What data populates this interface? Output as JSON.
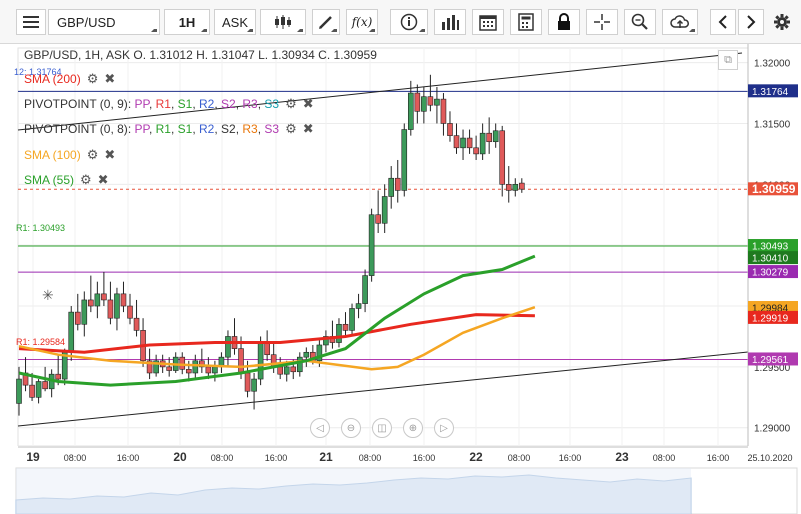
{
  "toolbar": {
    "symbol": "GBP/USD",
    "timeframe": "1H",
    "price_side": "ASK",
    "fx_label": "f(x)",
    "icons": [
      "menu-icon",
      "candlestick-icon",
      "draw-line-icon",
      "function-icon",
      "info-icon",
      "bar-chart-icon",
      "calendar-icon",
      "calculator-icon",
      "lock-icon",
      "crosshair-icon",
      "zoom-icon",
      "cloud-upload-icon",
      "chevron-left-icon",
      "chevron-right-icon",
      "gear-icon"
    ]
  },
  "header": {
    "ohlc": "GBP/USD, 1H, ASK   O. 1.31012 H. 1.31047 L. 1.30934 C. 1.30959"
  },
  "legend": {
    "sma200": {
      "label": "SMA (200)",
      "color": "#e8281e",
      "prefix": "12: 1.31764"
    },
    "pivot1": {
      "name": "PIVOTPOINT (0, 9)",
      "sep": ": ",
      "items": [
        {
          "t": "PP",
          "c": "#b03ab0"
        },
        {
          "t": "R1",
          "c": "#e83a3a"
        },
        {
          "t": "S1",
          "c": "#2aa02a"
        },
        {
          "t": "R2",
          "c": "#3a5fd0"
        },
        {
          "t": "S2",
          "c": "#b03ab0"
        },
        {
          "t": "R3",
          "c": "#b03ab0"
        },
        {
          "t": "S3",
          "c": "#16a0b0"
        }
      ]
    },
    "pivot2": {
      "name": "PIVOTPOINT (0, 8)",
      "sep": ": ",
      "items": [
        {
          "t": "PP",
          "c": "#b03ab0"
        },
        {
          "t": "R1",
          "c": "#2aa02a"
        },
        {
          "t": "S1",
          "c": "#2aa02a"
        },
        {
          "t": "R2",
          "c": "#3a5fd0"
        },
        {
          "t": "S2",
          "c": "#333333"
        },
        {
          "t": "R3",
          "c": "#e8760a"
        },
        {
          "t": "S3",
          "c": "#b03ab0"
        }
      ]
    },
    "sma100": {
      "label": "SMA (100)",
      "color": "#f5a623"
    },
    "sma55": {
      "label": "SMA (55)",
      "color": "#2aa02a"
    },
    "r1_text": "R1: 1.30493",
    "s_text": "R1: 1.29584"
  },
  "price_axis": {
    "ticks": [
      "1.32000",
      "1.31500",
      "1.31000",
      "1.30500",
      "1.30000",
      "1.29500",
      "1.29000"
    ],
    "badges": [
      {
        "text": "1.31764",
        "bg": "#1f2f8a",
        "fg": "#ffffff"
      },
      {
        "text": "1.30959",
        "bg": "#e8523a",
        "fg": "#ffffff"
      },
      {
        "text": "1.30493",
        "bg": "#2aa02a",
        "fg": "#ffffff"
      },
      {
        "text": "1.30410",
        "bg": "#1e7a1e",
        "fg": "#ffffff"
      },
      {
        "text": "1.30279",
        "bg": "#9a2ab0",
        "fg": "#ffffff"
      },
      {
        "text": "1.29984",
        "bg": "#f5a623",
        "fg": "#222222"
      },
      {
        "text": "1.29919",
        "bg": "#e8281e",
        "fg": "#ffffff"
      },
      {
        "text": "1.29561",
        "bg": "#b03ab0",
        "fg": "#ffffff"
      }
    ]
  },
  "time_axis": {
    "labels": [
      "19",
      "08:00",
      "16:00",
      "20",
      "08:00",
      "16:00",
      "21",
      "08:00",
      "16:00",
      "22",
      "08:00",
      "16:00",
      "23",
      "08:00",
      "16:00",
      "25.10.2020"
    ],
    "bold": [
      true,
      false,
      false,
      true,
      false,
      false,
      true,
      false,
      false,
      true,
      false,
      false,
      true,
      false,
      false,
      false
    ]
  },
  "chart_data": {
    "type": "candlestick",
    "ylim": [
      1.2885,
      1.3212
    ],
    "candles": [
      {
        "o": 1.292,
        "h": 1.295,
        "l": 1.291,
        "c": 1.294
      },
      {
        "o": 1.2945,
        "h": 1.2958,
        "l": 1.293,
        "c": 1.2935
      },
      {
        "o": 1.2935,
        "h": 1.2945,
        "l": 1.2922,
        "c": 1.2925
      },
      {
        "o": 1.2925,
        "h": 1.294,
        "l": 1.292,
        "c": 1.2938
      },
      {
        "o": 1.2938,
        "h": 1.295,
        "l": 1.293,
        "c": 1.2932
      },
      {
        "o": 1.2932,
        "h": 1.2948,
        "l": 1.2925,
        "c": 1.2944
      },
      {
        "o": 1.2944,
        "h": 1.296,
        "l": 1.2935,
        "c": 1.294
      },
      {
        "o": 1.294,
        "h": 1.2965,
        "l": 1.2935,
        "c": 1.2962
      },
      {
        "o": 1.2962,
        "h": 1.3,
        "l": 1.2955,
        "c": 1.2995
      },
      {
        "o": 1.2995,
        "h": 1.301,
        "l": 1.298,
        "c": 1.2985
      },
      {
        "o": 1.2985,
        "h": 1.3012,
        "l": 1.2975,
        "c": 1.3005
      },
      {
        "o": 1.3005,
        "h": 1.3025,
        "l": 1.2995,
        "c": 1.3
      },
      {
        "o": 1.3,
        "h": 1.302,
        "l": 1.299,
        "c": 1.301
      },
      {
        "o": 1.301,
        "h": 1.3028,
        "l": 1.3,
        "c": 1.3005
      },
      {
        "o": 1.3005,
        "h": 1.302,
        "l": 1.2985,
        "c": 1.299
      },
      {
        "o": 1.299,
        "h": 1.3015,
        "l": 1.298,
        "c": 1.301
      },
      {
        "o": 1.301,
        "h": 1.302,
        "l": 1.2995,
        "c": 1.3
      },
      {
        "o": 1.3,
        "h": 1.301,
        "l": 1.2985,
        "c": 1.299
      },
      {
        "o": 1.299,
        "h": 1.3005,
        "l": 1.2975,
        "c": 1.298
      },
      {
        "o": 1.298,
        "h": 1.299,
        "l": 1.295,
        "c": 1.2955
      },
      {
        "o": 1.2955,
        "h": 1.2965,
        "l": 1.294,
        "c": 1.2945
      },
      {
        "o": 1.2945,
        "h": 1.296,
        "l": 1.2942,
        "c": 1.2955
      },
      {
        "o": 1.2955,
        "h": 1.296,
        "l": 1.2945,
        "c": 1.295
      },
      {
        "o": 1.295,
        "h": 1.2958,
        "l": 1.2942,
        "c": 1.2947
      },
      {
        "o": 1.2947,
        "h": 1.2962,
        "l": 1.2945,
        "c": 1.2958
      },
      {
        "o": 1.2958,
        "h": 1.2962,
        "l": 1.2944,
        "c": 1.2948
      },
      {
        "o": 1.2948,
        "h": 1.2955,
        "l": 1.2938,
        "c": 1.2945
      },
      {
        "o": 1.2945,
        "h": 1.296,
        "l": 1.294,
        "c": 1.2955
      },
      {
        "o": 1.2955,
        "h": 1.2965,
        "l": 1.2945,
        "c": 1.295
      },
      {
        "o": 1.295,
        "h": 1.2958,
        "l": 1.294,
        "c": 1.2945
      },
      {
        "o": 1.2945,
        "h": 1.2955,
        "l": 1.2938,
        "c": 1.295
      },
      {
        "o": 1.295,
        "h": 1.2962,
        "l": 1.2945,
        "c": 1.2958
      },
      {
        "o": 1.2958,
        "h": 1.298,
        "l": 1.295,
        "c": 1.2975
      },
      {
        "o": 1.2975,
        "h": 1.299,
        "l": 1.296,
        "c": 1.2965
      },
      {
        "o": 1.2965,
        "h": 1.2975,
        "l": 1.294,
        "c": 1.2945
      },
      {
        "o": 1.2945,
        "h": 1.2955,
        "l": 1.2925,
        "c": 1.293
      },
      {
        "o": 1.293,
        "h": 1.2945,
        "l": 1.2915,
        "c": 1.294
      },
      {
        "o": 1.294,
        "h": 1.2975,
        "l": 1.2935,
        "c": 1.297
      },
      {
        "o": 1.297,
        "h": 1.298,
        "l": 1.2955,
        "c": 1.296
      },
      {
        "o": 1.296,
        "h": 1.297,
        "l": 1.2945,
        "c": 1.295
      },
      {
        "o": 1.295,
        "h": 1.2958,
        "l": 1.294,
        "c": 1.2944
      },
      {
        "o": 1.2944,
        "h": 1.2955,
        "l": 1.2938,
        "c": 1.295
      },
      {
        "o": 1.295,
        "h": 1.2956,
        "l": 1.294,
        "c": 1.2946
      },
      {
        "o": 1.2946,
        "h": 1.2962,
        "l": 1.2942,
        "c": 1.2958
      },
      {
        "o": 1.2958,
        "h": 1.2966,
        "l": 1.295,
        "c": 1.2962
      },
      {
        "o": 1.2962,
        "h": 1.2968,
        "l": 1.2952,
        "c": 1.2955
      },
      {
        "o": 1.2955,
        "h": 1.2972,
        "l": 1.295,
        "c": 1.2968
      },
      {
        "o": 1.2968,
        "h": 1.298,
        "l": 1.2962,
        "c": 1.2975
      },
      {
        "o": 1.2975,
        "h": 1.2988,
        "l": 1.2965,
        "c": 1.297
      },
      {
        "o": 1.297,
        "h": 1.299,
        "l": 1.2966,
        "c": 1.2985
      },
      {
        "o": 1.2985,
        "h": 1.2995,
        "l": 1.2976,
        "c": 1.298
      },
      {
        "o": 1.298,
        "h": 1.3002,
        "l": 1.2975,
        "c": 1.2998
      },
      {
        "o": 1.2998,
        "h": 1.301,
        "l": 1.299,
        "c": 1.3002
      },
      {
        "o": 1.3002,
        "h": 1.303,
        "l": 1.2995,
        "c": 1.3025
      },
      {
        "o": 1.3025,
        "h": 1.308,
        "l": 1.302,
        "c": 1.3075
      },
      {
        "o": 1.3075,
        "h": 1.3095,
        "l": 1.306,
        "c": 1.3068
      },
      {
        "o": 1.3068,
        "h": 1.31,
        "l": 1.306,
        "c": 1.309
      },
      {
        "o": 1.309,
        "h": 1.3115,
        "l": 1.308,
        "c": 1.3105
      },
      {
        "o": 1.3105,
        "h": 1.312,
        "l": 1.3085,
        "c": 1.3095
      },
      {
        "o": 1.3095,
        "h": 1.315,
        "l": 1.309,
        "c": 1.3145
      },
      {
        "o": 1.3145,
        "h": 1.3185,
        "l": 1.314,
        "c": 1.3175
      },
      {
        "o": 1.3175,
        "h": 1.3182,
        "l": 1.315,
        "c": 1.316
      },
      {
        "o": 1.316,
        "h": 1.318,
        "l": 1.315,
        "c": 1.3172
      },
      {
        "o": 1.3172,
        "h": 1.319,
        "l": 1.316,
        "c": 1.3165
      },
      {
        "o": 1.3165,
        "h": 1.318,
        "l": 1.315,
        "c": 1.317
      },
      {
        "o": 1.317,
        "h": 1.3175,
        "l": 1.314,
        "c": 1.315
      },
      {
        "o": 1.315,
        "h": 1.316,
        "l": 1.3135,
        "c": 1.314
      },
      {
        "o": 1.314,
        "h": 1.315,
        "l": 1.3125,
        "c": 1.313
      },
      {
        "o": 1.313,
        "h": 1.3145,
        "l": 1.312,
        "c": 1.3138
      },
      {
        "o": 1.3138,
        "h": 1.3145,
        "l": 1.3125,
        "c": 1.313
      },
      {
        "o": 1.313,
        "h": 1.314,
        "l": 1.312,
        "c": 1.3125
      },
      {
        "o": 1.3125,
        "h": 1.315,
        "l": 1.312,
        "c": 1.3142
      },
      {
        "o": 1.3142,
        "h": 1.3155,
        "l": 1.3125,
        "c": 1.3135
      },
      {
        "o": 1.3135,
        "h": 1.315,
        "l": 1.313,
        "c": 1.3144
      },
      {
        "o": 1.3144,
        "h": 1.3148,
        "l": 1.309,
        "c": 1.31
      },
      {
        "o": 1.31,
        "h": 1.3115,
        "l": 1.3085,
        "c": 1.3095
      },
      {
        "o": 1.3095,
        "h": 1.3105,
        "l": 1.309,
        "c": 1.31
      },
      {
        "o": 1.3101,
        "h": 1.3105,
        "l": 1.3093,
        "c": 1.3096
      }
    ],
    "sma200": [
      [
        0,
        1.2965
      ],
      [
        10,
        1.2962
      ],
      [
        20,
        1.2968
      ],
      [
        30,
        1.297
      ],
      [
        40,
        1.297
      ],
      [
        50,
        1.2975
      ],
      [
        60,
        1.2985
      ],
      [
        70,
        1.2993
      ],
      [
        79,
        1.2992
      ]
    ],
    "sma100": [
      [
        0,
        1.2967
      ],
      [
        6,
        1.296
      ],
      [
        14,
        1.2955
      ],
      [
        24,
        1.2952
      ],
      [
        34,
        1.295
      ],
      [
        44,
        1.2955
      ],
      [
        54,
        1.2948
      ],
      [
        58,
        1.295
      ],
      [
        62,
        1.296
      ],
      [
        68,
        1.2978
      ],
      [
        74,
        1.299
      ],
      [
        79,
        1.2999
      ]
    ],
    "sma55": [
      [
        0,
        1.2945
      ],
      [
        6,
        1.2938
      ],
      [
        14,
        1.2935
      ],
      [
        24,
        1.2938
      ],
      [
        34,
        1.2945
      ],
      [
        44,
        1.2955
      ],
      [
        50,
        1.2965
      ],
      [
        56,
        1.299
      ],
      [
        62,
        1.301
      ],
      [
        68,
        1.3025
      ],
      [
        74,
        1.303
      ],
      [
        79,
        1.3041
      ]
    ]
  }
}
